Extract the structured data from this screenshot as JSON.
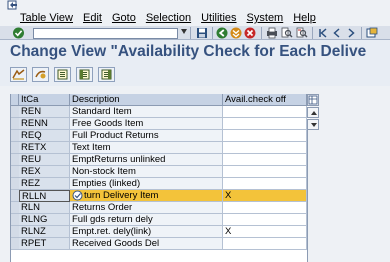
{
  "menu": {
    "items": [
      "Table View",
      "Edit",
      "Goto",
      "Selection",
      "Utilities",
      "System",
      "Help"
    ]
  },
  "toolbar": {
    "command_field_value": "",
    "icons": [
      "enter-check-icon",
      "save-icon",
      "back-icon",
      "exit-icon",
      "cancel-icon",
      "print-icon",
      "find-icon",
      "find-next-icon",
      "first-page-icon",
      "create-session-icon"
    ]
  },
  "title": "Change View \"Availability Check for Each Delive",
  "app_toolbar": {
    "icons": [
      "display-change-icon",
      "new-entries-icon",
      "copy-icon",
      "delete-icon",
      "undo-icon"
    ]
  },
  "table": {
    "headers": [
      "ItCa",
      "Description",
      "Avail.check off"
    ],
    "rows": [
      {
        "itca": "REN",
        "desc": "Standard Item",
        "chk": ""
      },
      {
        "itca": "RENN",
        "desc": "Free Goods Item",
        "chk": ""
      },
      {
        "itca": "REQ",
        "desc": "Full Product Returns",
        "chk": ""
      },
      {
        "itca": "RETX",
        "desc": "Text Item",
        "chk": ""
      },
      {
        "itca": "REU",
        "desc": "EmptReturns unlinked",
        "chk": ""
      },
      {
        "itca": "REX",
        "desc": "Non-stock Item",
        "chk": ""
      },
      {
        "itca": "REZ",
        "desc": "Empties (linked)",
        "chk": ""
      },
      {
        "itca": "RLLN",
        "desc": "turn Delivery Item",
        "chk": "X"
      },
      {
        "itca": "RLN",
        "desc": "Returns Order",
        "chk": ""
      },
      {
        "itca": "RLNG",
        "desc": "Full gds return dely",
        "chk": ""
      },
      {
        "itca": "RLNZ",
        "desc": "Empt.ret. dely(link)",
        "chk": "X"
      },
      {
        "itca": "RPET",
        "desc": "Received Goods Del",
        "chk": ""
      }
    ],
    "selected_row": 7
  },
  "colors": {
    "title": "#36527f",
    "header_bg": "#c6d2e4",
    "selected_row": "#f3c33a"
  }
}
